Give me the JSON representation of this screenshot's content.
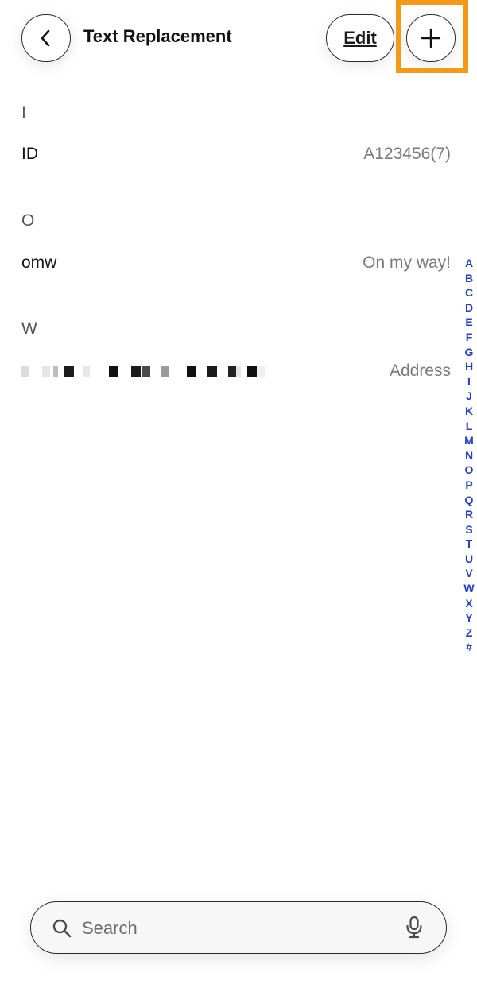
{
  "header": {
    "title": "Text Replacement",
    "edit_label": "Edit",
    "back_icon": "chevron-left-icon",
    "add_icon": "plus-icon"
  },
  "sections": [
    {
      "letter": "I",
      "items": [
        {
          "phrase": "ID",
          "shortcut": "A123456(7)"
        }
      ]
    },
    {
      "letter": "O",
      "items": [
        {
          "phrase": "omw",
          "shortcut": "On my way!"
        }
      ]
    },
    {
      "letter": "W",
      "items": [
        {
          "phrase": "[redacted]",
          "shortcut": "Address"
        }
      ]
    }
  ],
  "alphabet_index": [
    "A",
    "B",
    "C",
    "D",
    "E",
    "F",
    "G",
    "H",
    "I",
    "J",
    "K",
    "L",
    "M",
    "N",
    "O",
    "P",
    "Q",
    "R",
    "S",
    "T",
    "U",
    "V",
    "W",
    "X",
    "Y",
    "Z",
    "#"
  ],
  "search": {
    "placeholder": "Search",
    "search_icon": "magnifier-icon",
    "mic_icon": "microphone-icon"
  },
  "colors": {
    "highlight": "#f59a17",
    "index_blue": "#1f3fd0"
  }
}
